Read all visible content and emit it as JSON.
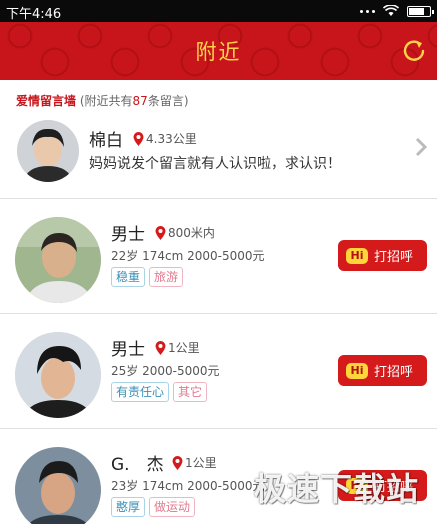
{
  "status": {
    "time": "下午4:46"
  },
  "header": {
    "title": "附近"
  },
  "wall": {
    "label": "爱情留言墙",
    "prefix": "(附近共有",
    "count": "87",
    "suffix": "条留言)"
  },
  "note": {
    "name": "棉白",
    "distance": "4.33公里",
    "message": "妈妈说发个留言就有人认识啦，求认识！"
  },
  "people": [
    {
      "name": "男士",
      "distance": "800米内",
      "meta": "22岁 174cm 2000-5000元",
      "tags": [
        "稳重",
        "旅游"
      ],
      "button": "打招呼"
    },
    {
      "name": "男士",
      "distance": "1公里",
      "meta": "25岁 2000-5000元",
      "tags": [
        "有责任心",
        "其它"
      ],
      "button": "打招呼"
    },
    {
      "name": "G.　杰",
      "distance": "1公里",
      "meta": "23岁 174cm 2000-5000元",
      "tags": [
        "憨厚",
        "做运动"
      ],
      "button": "打招呼"
    }
  ],
  "hi_badge": "Hi",
  "watermark": "极速下载站",
  "colors": {
    "brand_red": "#c8151b",
    "title_gold": "#ffd24a",
    "tag_blue": "#3a8fb7",
    "tag_pink": "#e07a8f"
  }
}
